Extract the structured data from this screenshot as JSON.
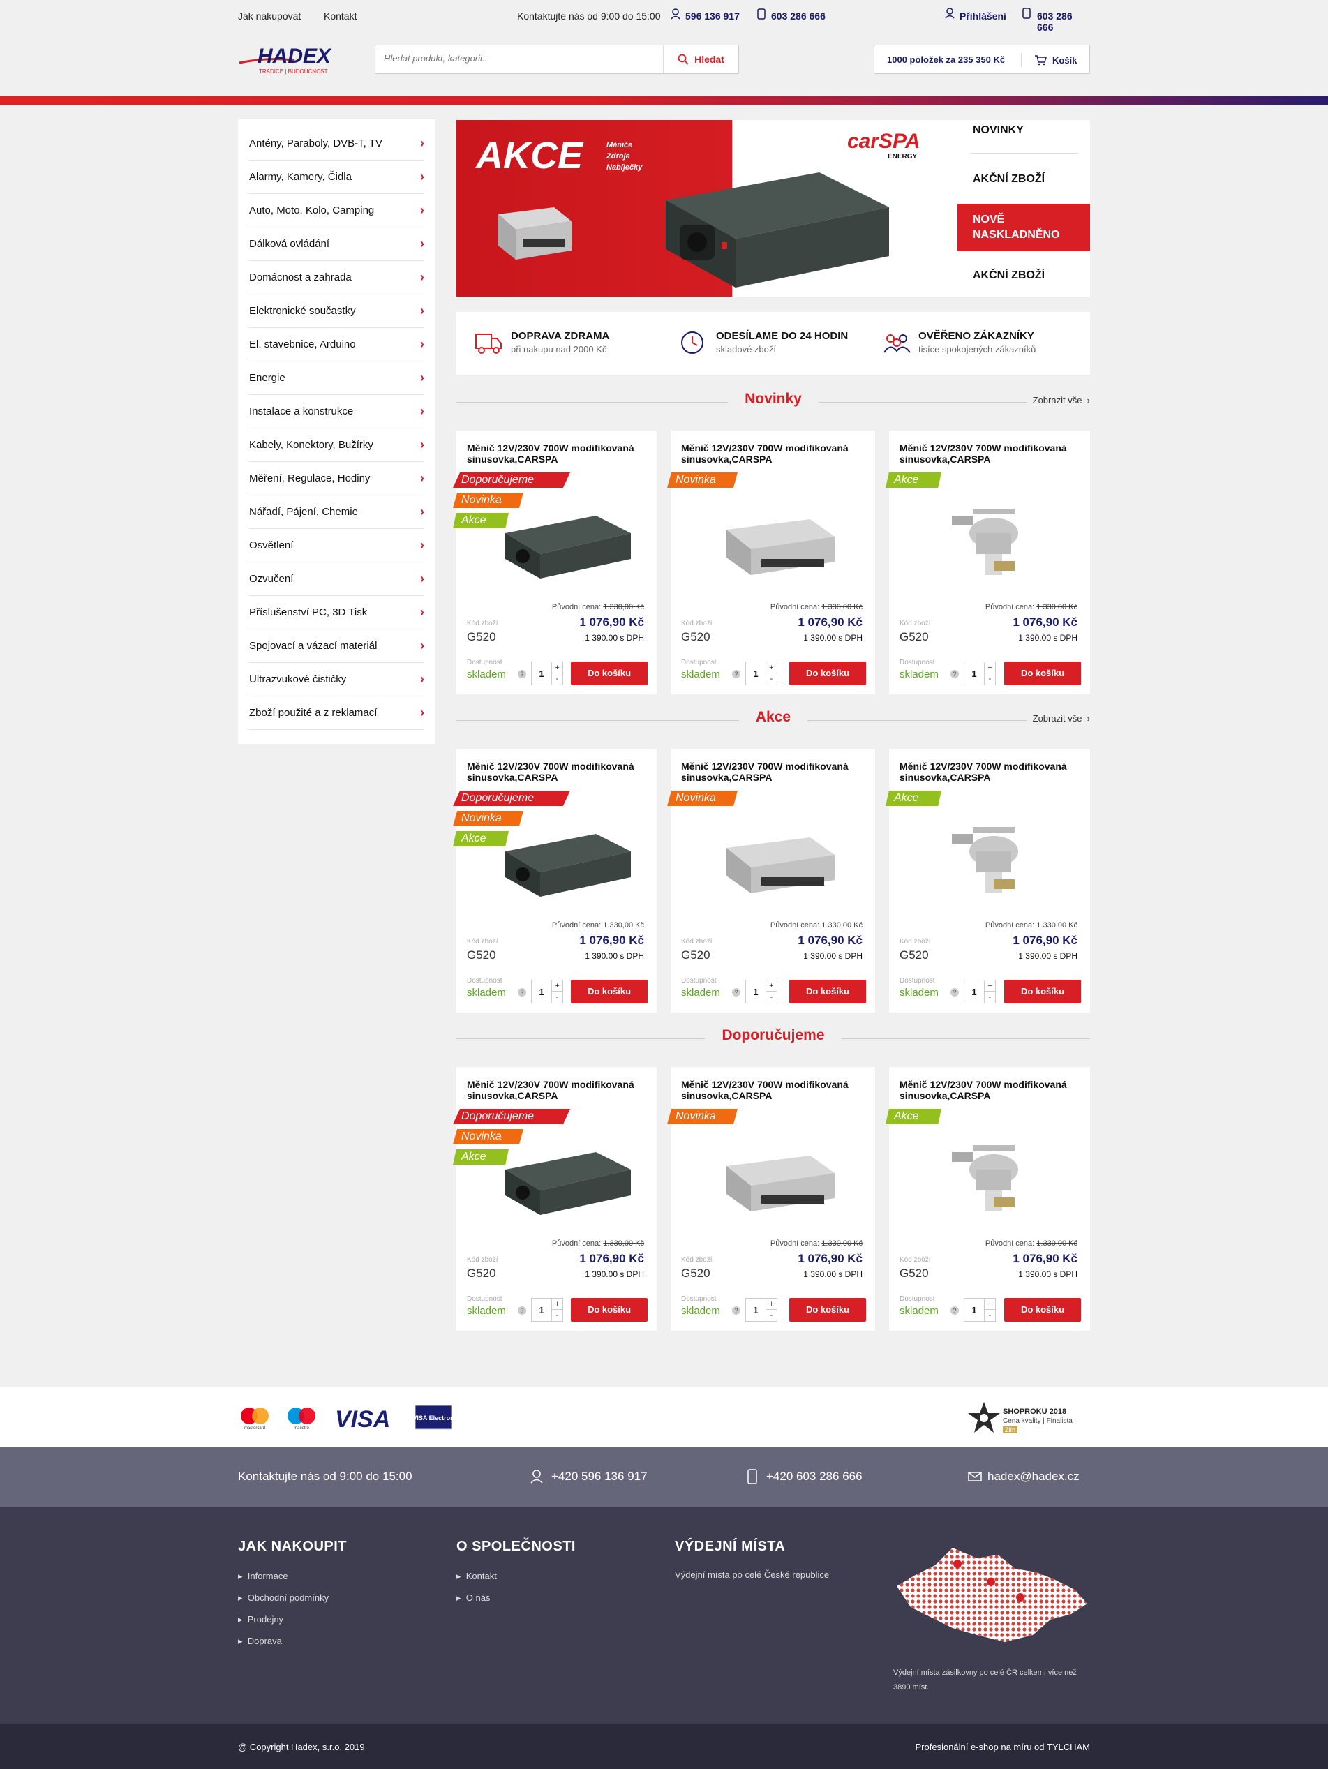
{
  "topbar": {
    "link_how": "Jak nakupovat",
    "link_contact": "Kontakt",
    "hours": "Kontaktujte nás od 9:00 do 15:00",
    "phone1": "596 136 917",
    "phone2": "603 286 666",
    "login": "Přihlášení",
    "phone3": "603 286 666"
  },
  "header": {
    "logo_text": "HADEX",
    "logo_sub": "TRADICE | BUDOUCNOST",
    "search_placeholder": "Hledat produkt, kategorii...",
    "search_button": "Hledat",
    "cart_summary_prefix": "1000 položek za",
    "cart_summary_amount": "235 350 Kč",
    "cart_label": "Košík"
  },
  "sidebar": {
    "items": [
      "Antény, Paraboly, DVB-T, TV",
      "Alarmy, Kamery, Čidla",
      "Auto, Moto, Kolo, Camping",
      "Dálková ovládání",
      "Domácnost a zahrada",
      "Elektronické součastky",
      "El. stavebnice, Arduino",
      "Energie",
      "Instalace a konstrukce",
      "Kabely, Konektory, Bužírky",
      "Měření, Regulace, Hodiny",
      "Nářadí, Pájení, Chemie",
      "Osvětlení",
      "Ozvučení",
      "Příslušenství PC, 3D Tisk",
      "Spojovací a vázací materiál",
      "Ultrazvukové čističky",
      "Zboží použité a z reklamací"
    ]
  },
  "banner": {
    "headline": "AKCE",
    "sub1": "Měniče",
    "sub2": "Zdroje",
    "sub3": "Nabíječky",
    "brand": "carSPA",
    "brand_sub": "ENERGY",
    "nav": [
      "NOVINKY",
      "AKČNÍ ZBOŽÍ",
      "NOVĚ NASKLADNĚNO",
      "AKČNÍ ZBOŽÍ"
    ]
  },
  "features": [
    {
      "title": "DOPRAVA ZDRAMA",
      "sub": "při nakupu nad 2000 Kč"
    },
    {
      "title": "ODESÍLAME DO 24 HODIN",
      "sub": "skladové zboží"
    },
    {
      "title": "OVĚŘENO ZÁKAZNÍKY",
      "sub": "tisíce spokojených zákazníků"
    }
  ],
  "sections": [
    {
      "title": "Novinky",
      "show_all": "Zobrazit vše"
    },
    {
      "title": "Akce",
      "show_all": "Zobrazit vše"
    },
    {
      "title": "Doporučujeme",
      "show_all": ""
    }
  ],
  "product": {
    "name": "Měnič 12V/230V 700W modifikovaná sinusovka,CARSPA",
    "orig_label": "Původní cena:",
    "orig_price": "1.330,00 Kč",
    "code_label": "Kód zboží",
    "code": "G520",
    "price": "1 076,90 Kč",
    "price_vat": "1 390.00 s DPH",
    "avail_label": "Dostupnost",
    "avail": "skladem",
    "qty": "1",
    "buy": "Do košíku",
    "tag_dop": "Doporučujeme",
    "tag_nov": "Novinka",
    "tag_akc": "Akce"
  },
  "footer": {
    "payments": [
      "mastercard",
      "maestro",
      "VISA",
      "VISA Electron"
    ],
    "award_title": "SHOPROKU 2018",
    "award_sub1": "Cena kvality",
    "award_sub2": "Finalista",
    "award_sub3": "Zlín",
    "contact_hours": "Kontaktujte nás od 9:00 do 15:00",
    "contact_phone1": "+420 596 136 917",
    "contact_phone2": "+420 603 286 666",
    "contact_email": "hadex@hadex.cz",
    "col1_title": "JAK NAKOUPIT",
    "col1_items": [
      "Informace",
      "Obchodní podmínky",
      "Prodejny",
      "Doprava"
    ],
    "col2_title": "O SPOLEČNOSTI",
    "col2_items": [
      "Kontakt",
      "O nás"
    ],
    "col3_title": "VÝDEJNÍ MÍSTA",
    "col3_text": "Výdejní místa po celé České republice",
    "map_note_line1": "Výdejní místa zásilkovny po celé ČR celkem, více než",
    "map_note_line2": "3890 míst.",
    "copyright": "@ Copyright Hadex, s.r.o. 2019",
    "credit": "Profesionální e-shop na míru od TYLCHAM"
  },
  "colors": {
    "accent": "#d91f26",
    "navy": "#1b1b6b",
    "green": "#5aa81e",
    "orange": "#f06a12",
    "lime": "#93bf1f"
  }
}
